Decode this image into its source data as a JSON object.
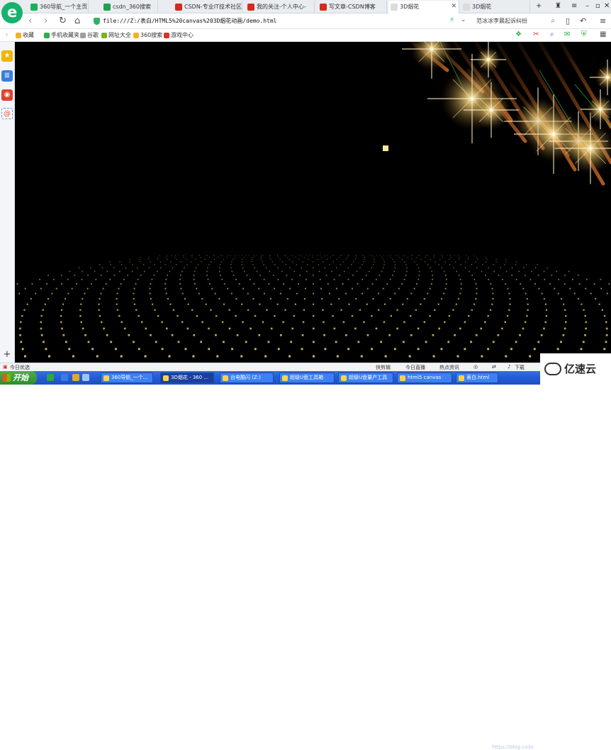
{
  "tabs": [
    {
      "label": "360导航_一个主页",
      "fav": "#19b25a"
    },
    {
      "label": "csdn_360搜索",
      "fav": "#1fa14f"
    },
    {
      "label": "CSDN-专业IT技术社区",
      "fav": "#d42b1e"
    },
    {
      "label": "我的关注-个人中心-",
      "fav": "#d42b1e"
    },
    {
      "label": "写文章-CSDN博客",
      "fav": "#d42b1e"
    },
    {
      "label": "3D烟花",
      "fav": "#dcdcdc",
      "active": true
    },
    {
      "label": "3D烟花",
      "fav": "#dcdcdc"
    }
  ],
  "address_bar": {
    "url": "file:///Z:/表白/HTML5%20canvas%203D烟花动画/demo.html"
  },
  "search_box": {
    "placeholder": "范冰冰李晨起诉纠纷"
  },
  "bookmarks": [
    {
      "label": "收藏",
      "color": "#f3b31b"
    },
    {
      "label": "手机收藏夹",
      "color": "#2fae4a"
    },
    {
      "label": "谷歌",
      "color": "#9aa0a6"
    },
    {
      "label": "网址大全",
      "color": "#7ab51d"
    },
    {
      "label": "360搜索",
      "color": "#f3b31b"
    },
    {
      "label": "游戏中心",
      "color": "#d9322d"
    }
  ],
  "status_bar": {
    "left": "今日优选",
    "items": [
      "快剪辑",
      "今日直播",
      "热点资讯"
    ],
    "download": "下载"
  },
  "taskbar": {
    "start": "开始",
    "tasks": [
      {
        "label": "360导航_一个...",
        "active": false
      },
      {
        "label": "3D烟花 - 360 ...",
        "active": true
      },
      {
        "label": "台电酷闪 (Z:)",
        "active": false
      },
      {
        "label": "超级U盘工具箱",
        "active": false
      },
      {
        "label": "超级U盘量产工具",
        "active": false
      },
      {
        "label": "html5 canvas",
        "active": false
      },
      {
        "label": "表白.html",
        "active": false
      }
    ],
    "watermark_url": "https://blog.csdn"
  },
  "watermark_brand": "亿速云",
  "colors": {
    "accent": "#17b36a",
    "spark": "#ffe79a",
    "dot": "#d8c86a"
  }
}
